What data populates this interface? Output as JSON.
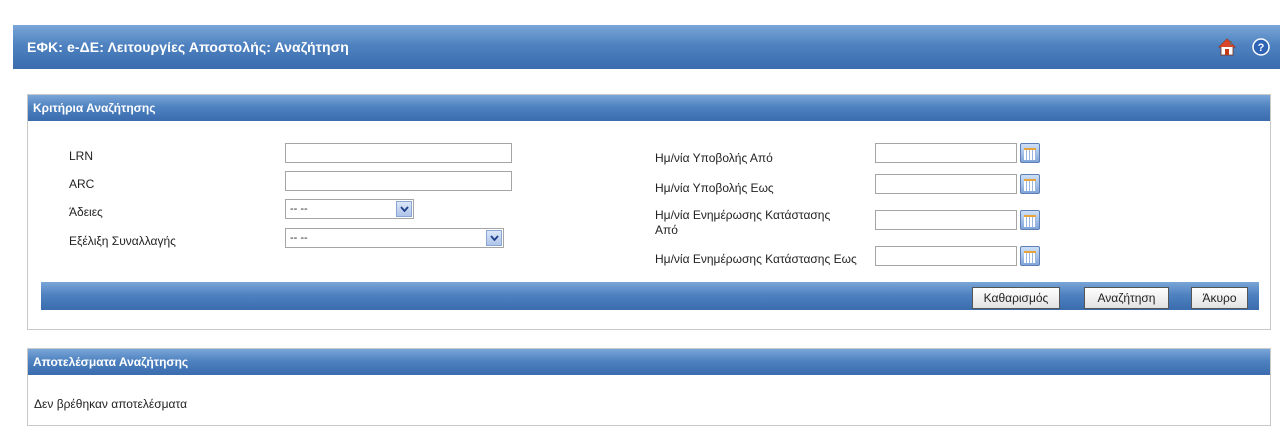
{
  "header": {
    "title": "ΕΦΚ: e-ΔΕ: Λειτουργίες Αποστολής: Αναζήτηση",
    "home_icon": "home-icon",
    "help_icon": "help-icon",
    "help_glyph": "?"
  },
  "criteria": {
    "title": "Κριτήρια Αναζήτησης",
    "lrn": {
      "label": "LRN",
      "value": ""
    },
    "arc": {
      "label": "ARC",
      "value": ""
    },
    "permits": {
      "label": "Άδειες",
      "value": "-- --"
    },
    "transaction_progress": {
      "label": "Εξέλιξη Συναλλαγής",
      "value": "-- --"
    },
    "submission_date_from": {
      "label": "Ημ/νία Υποβολής Από",
      "value": ""
    },
    "submission_date_to": {
      "label": "Ημ/νία Υποβολής Εως",
      "value": ""
    },
    "status_update_from": {
      "label_line1": "Ημ/νία Ενημέρωσης Κατάστασης",
      "label_line2": "Από",
      "value": ""
    },
    "status_update_to": {
      "label": "Ημ/νία Ενημέρωσης Κατάστασης Εως",
      "value": ""
    }
  },
  "buttons": {
    "clear": "Καθαρισμός",
    "search": "Αναζήτηση",
    "cancel": "Άκυρο"
  },
  "results": {
    "title": "Αποτελέσματα Αναζήτησης",
    "empty_message": "Δεν βρέθηκαν αποτελέσματα"
  }
}
